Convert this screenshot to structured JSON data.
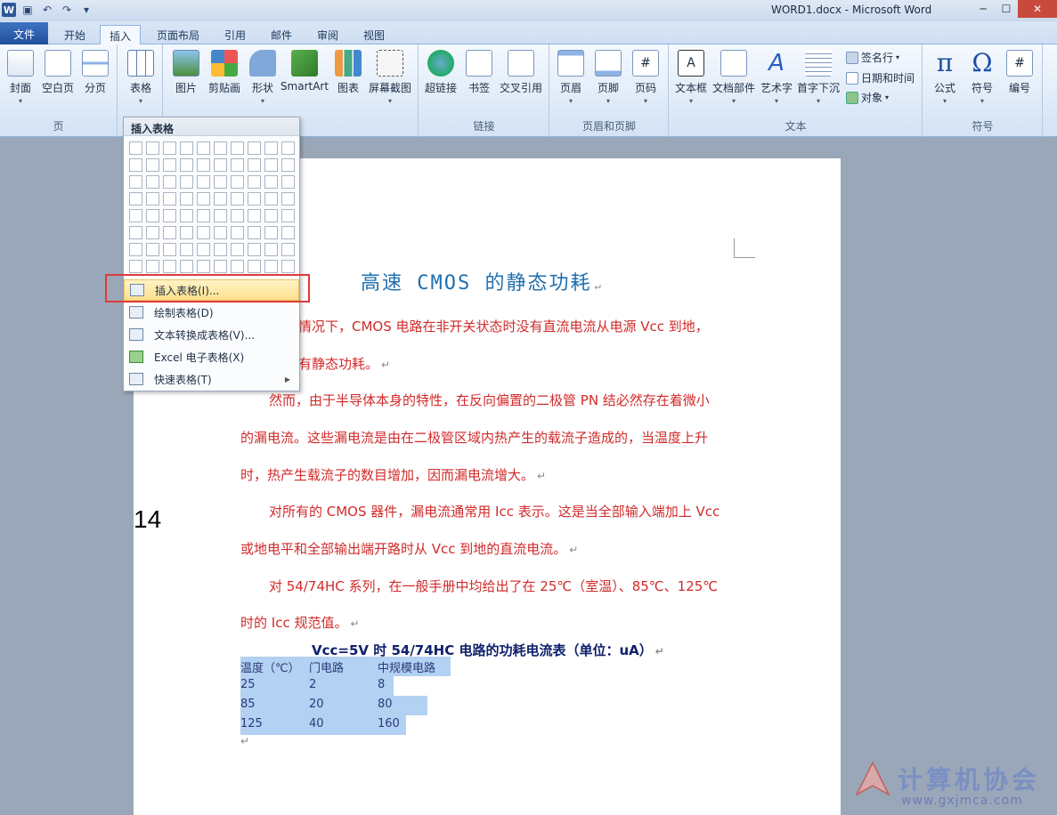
{
  "window": {
    "title": "WORD1.docx - Microsoft Word"
  },
  "tabs": [
    "文件",
    "开始",
    "插入",
    "页面布局",
    "引用",
    "邮件",
    "审阅",
    "视图"
  ],
  "ribbon": {
    "groups": {
      "pages": {
        "label": "页",
        "buttons": [
          "封面",
          "空白页",
          "分页"
        ]
      },
      "tables": {
        "button": "表格"
      },
      "illustrations": {
        "buttons": [
          "图片",
          "剪贴画",
          "形状",
          "SmartArt",
          "图表",
          "屏幕截图"
        ]
      },
      "links": {
        "label": "链接",
        "buttons": [
          "超链接",
          "书签",
          "交叉引用"
        ]
      },
      "header_footer": {
        "label": "页眉和页脚",
        "buttons": [
          "页眉",
          "页脚",
          "页码"
        ]
      },
      "text": {
        "label": "文本",
        "buttons": [
          "文本框",
          "文档部件",
          "艺术字",
          "首字下沉"
        ],
        "small": [
          "签名行",
          "日期和时间",
          "对象"
        ]
      },
      "symbols": {
        "label": "符号",
        "buttons": [
          "公式",
          "符号",
          "编号"
        ]
      }
    }
  },
  "dropdown": {
    "header": "插入表格",
    "grid_rows": 8,
    "grid_cols": 10,
    "items": [
      {
        "label": "插入表格(I)...",
        "highlighted": true
      },
      {
        "label": "绘制表格(D)",
        "highlighted": false
      },
      {
        "label": "文本转换成表格(V)...",
        "highlighted": false
      },
      {
        "label": "Excel 电子表格(X)",
        "highlighted": false
      },
      {
        "label": "快速表格(T)",
        "highlighted": false,
        "submenu": true
      }
    ]
  },
  "document": {
    "title": "高速 CMOS 的静态功耗",
    "lines": [
      "想情况下，CMOS 电路在非开关状态时没有直流电流从电源 Vcc 到地，",
      "没有静态功耗。",
      "然而，由于半导体本身的特性，在反向偏置的二极管 PN 结必然存在着微小",
      "的漏电流。这些漏电流是由在二极管区域内热产生的载流子造成的，当温度上升",
      "时，热产生载流子的数目增加，因而漏电流增大。",
      "对所有的 CMOS 器件，漏电流通常用 Icc 表示。这是当全部输入端加上 Vcc",
      "或地电平和全部输出端开路时从 Vcc 到地的直流电流。",
      "对  54/74HC  系列，在一般手册中均给出了在  25℃（室温）、85℃、125℃",
      "时的 Icc 规范值。"
    ],
    "table_caption": "Vcc=5V 时 54/74HC 电路的功耗电流表（单位：uA）",
    "table": {
      "headers": [
        "温度（℃）",
        "门电路",
        "中规模电路"
      ],
      "rows": [
        [
          "25",
          "2",
          "8"
        ],
        [
          "85",
          "20",
          "80"
        ],
        [
          "125",
          "40",
          "160"
        ]
      ]
    },
    "side_number": "14"
  },
  "watermark": {
    "text": "计算机协会",
    "url": "www.gxjmca.com"
  }
}
